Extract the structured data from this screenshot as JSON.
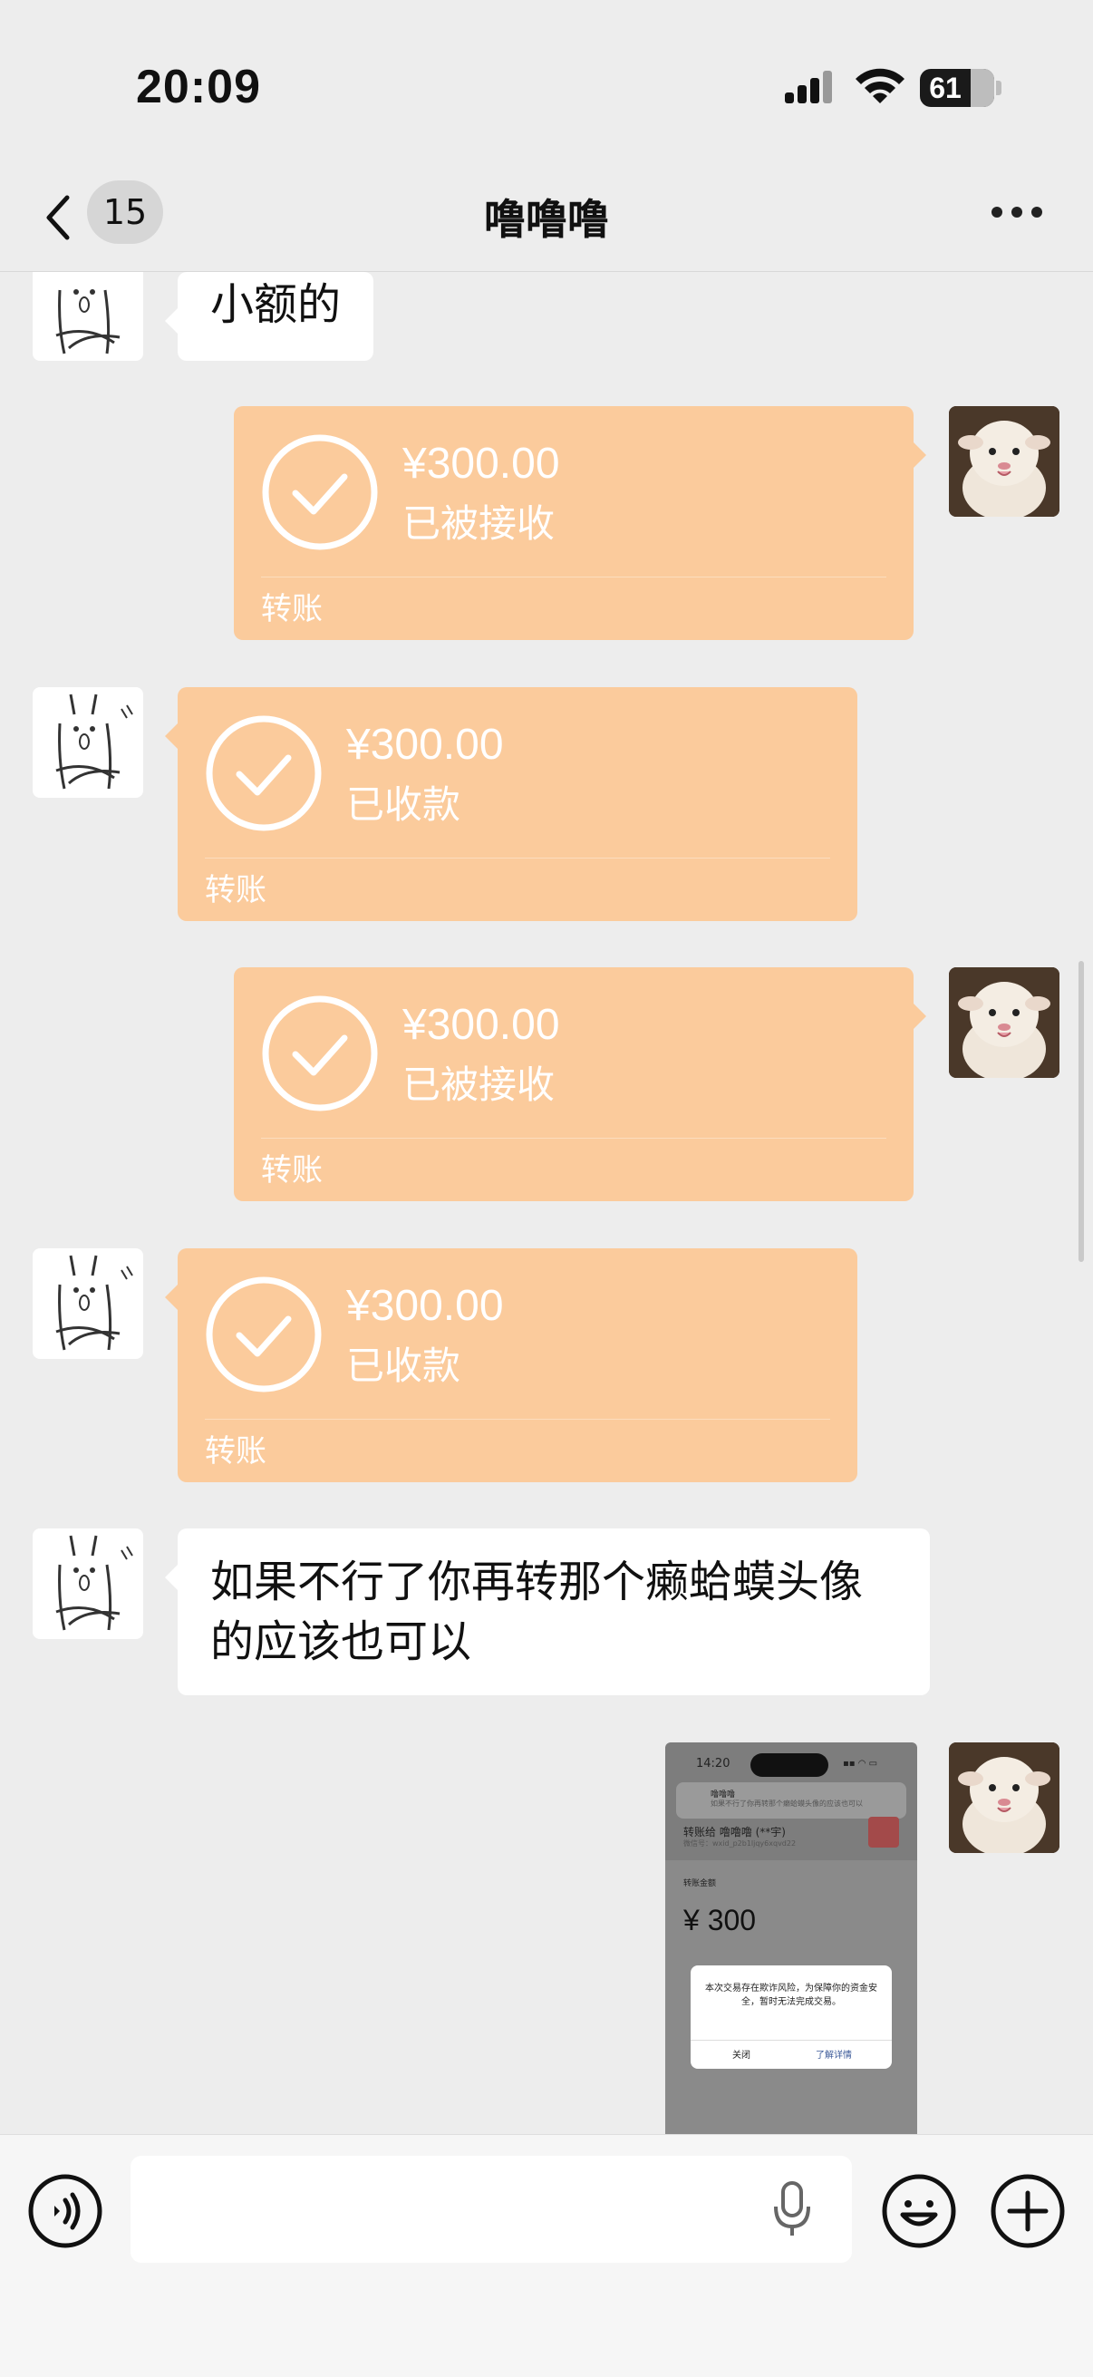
{
  "status_bar": {
    "time": "20:09",
    "battery": "61"
  },
  "nav": {
    "unread_count": "15",
    "title": "噜噜噜"
  },
  "messages": {
    "m0_text": "小额的",
    "t1": {
      "amount": "¥300.00",
      "status": "已被接收",
      "kind": "转账"
    },
    "t2": {
      "amount": "¥300.00",
      "status": "已收款",
      "kind": "转账"
    },
    "t3": {
      "amount": "¥300.00",
      "status": "已被接收",
      "kind": "转账"
    },
    "t4": {
      "amount": "¥300.00",
      "status": "已收款",
      "kind": "转账"
    },
    "m5_line1": "如果不行了你再转那个癞蛤蟆头像",
    "m5_line2": "的应该也可以"
  },
  "screenshot_thumb": {
    "time": "14:20",
    "notif_title": "噜噜噜",
    "notif_body": "如果不行了你再转那个癞蛤蟆头像的应该也可以",
    "transfer_to": "转账给 噜噜噜 (**宇)",
    "wechat_id": "微信号：wxid_p2b1ljqy6xqvd22",
    "amount_label": "转账金额",
    "amount": "¥ 300",
    "dialog_text": "本次交易存在欺诈风险，为保障你的资金安全，暂时无法完成交易。",
    "close_label": "关闭",
    "learn_label": "了解详情"
  },
  "colors": {
    "transfer_bg": "#fbcb9c",
    "background": "#ededed"
  }
}
